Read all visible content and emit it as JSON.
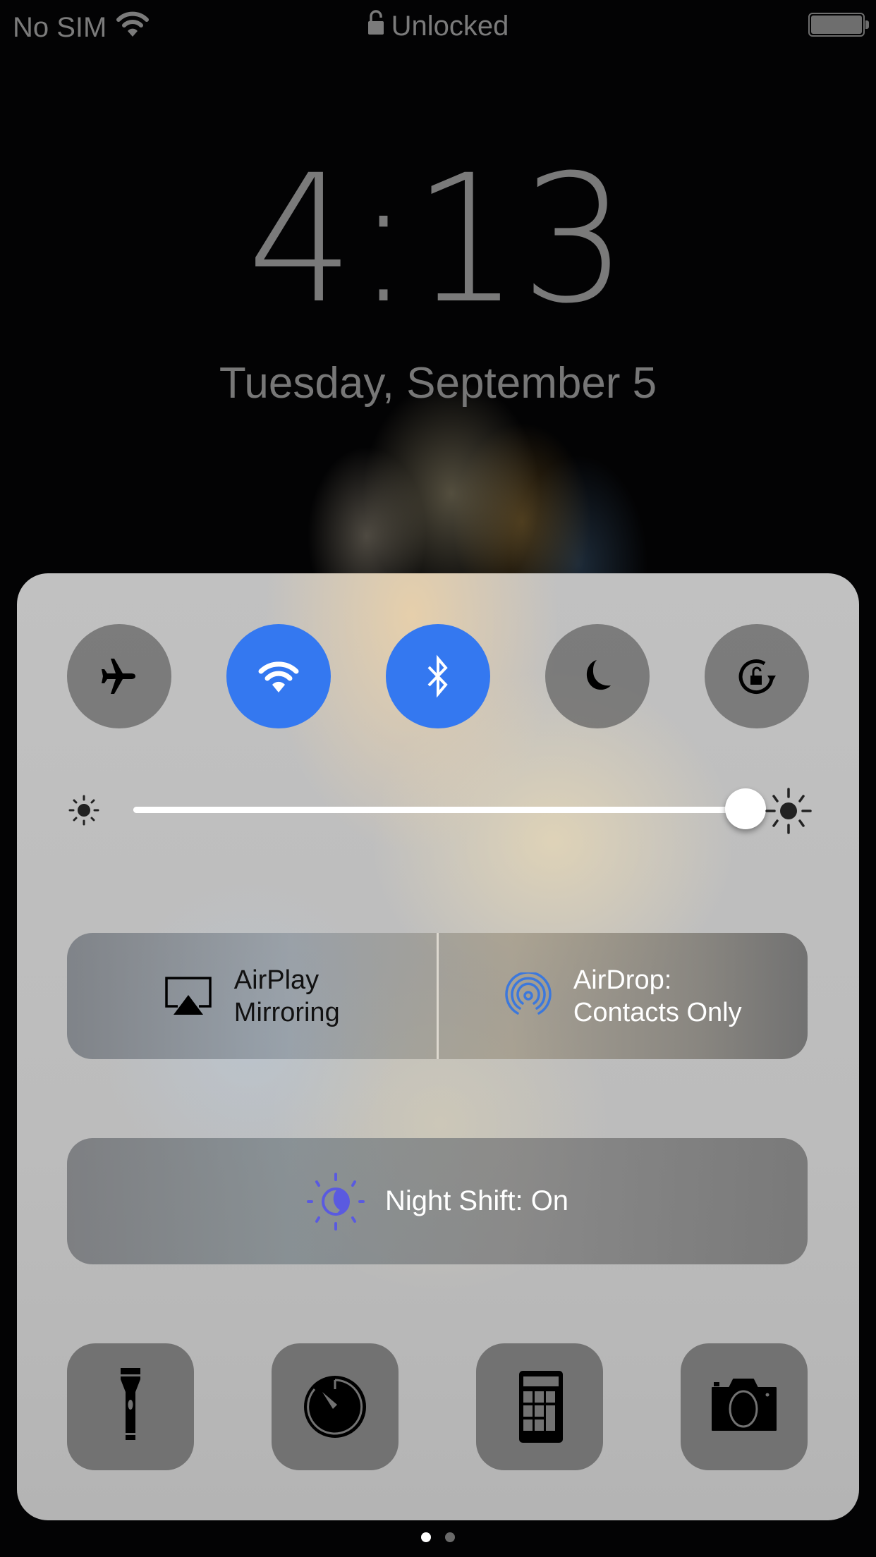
{
  "status_bar": {
    "carrier": "No SIM",
    "lock_status": "Unlocked",
    "battery_level_percent": 100
  },
  "lock_screen": {
    "time": "4:13",
    "date": "Tuesday, September 5"
  },
  "control_center": {
    "toggles": [
      {
        "id": "airplane-mode",
        "icon": "airplane-icon",
        "state": "off"
      },
      {
        "id": "wifi",
        "icon": "wifi-icon",
        "state": "on"
      },
      {
        "id": "bluetooth",
        "icon": "bluetooth-icon",
        "state": "on"
      },
      {
        "id": "do-not-disturb",
        "icon": "moon-icon",
        "state": "off"
      },
      {
        "id": "rotation-lock",
        "icon": "rotation-lock-icon",
        "state": "off"
      }
    ],
    "brightness": {
      "value_percent": 100,
      "min_icon": "sun-small-icon",
      "max_icon": "sun-large-icon"
    },
    "airplay": {
      "line1": "AirPlay",
      "line2": "Mirroring",
      "icon": "airplay-icon"
    },
    "airdrop": {
      "line1": "AirDrop:",
      "line2": "Contacts Only",
      "icon": "airdrop-icon"
    },
    "night_shift": {
      "label": "Night Shift: On",
      "icon": "night-shift-icon"
    },
    "shortcuts": [
      {
        "id": "flashlight",
        "icon": "flashlight-icon"
      },
      {
        "id": "timer",
        "icon": "timer-icon"
      },
      {
        "id": "calculator",
        "icon": "calculator-icon"
      },
      {
        "id": "camera",
        "icon": "camera-icon"
      }
    ]
  },
  "colors": {
    "accent_blue": "#3478f0",
    "night_shift_purple": "#5a5ae0",
    "airdrop_blue": "#3c78dc"
  },
  "page_indicator": {
    "pages": 2,
    "current": 1
  }
}
